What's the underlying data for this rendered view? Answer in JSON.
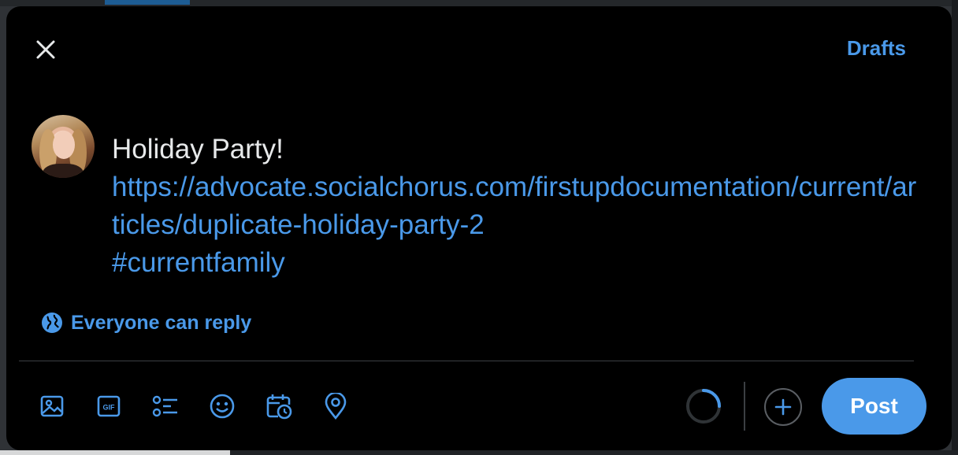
{
  "header": {
    "drafts_label": "Drafts"
  },
  "compose": {
    "title_text": "Holiday Party!",
    "link_text": "https://advocate.socialchorus.com/firstupdocumentation/current/articles/duplicate-holiday-party-2",
    "hashtag_text": "#currentfamily"
  },
  "reply_setting": {
    "label": "Everyone can reply",
    "icon": "globe-icon"
  },
  "toolbar": {
    "icons": [
      "image-icon",
      "gif-icon",
      "poll-icon",
      "emoji-icon",
      "schedule-icon",
      "location-icon"
    ]
  },
  "actions": {
    "post_label": "Post"
  },
  "colors": {
    "accent": "#4a99e9",
    "background": "#000000",
    "text": "#e7e9ea",
    "divider": "#3b3f43"
  }
}
